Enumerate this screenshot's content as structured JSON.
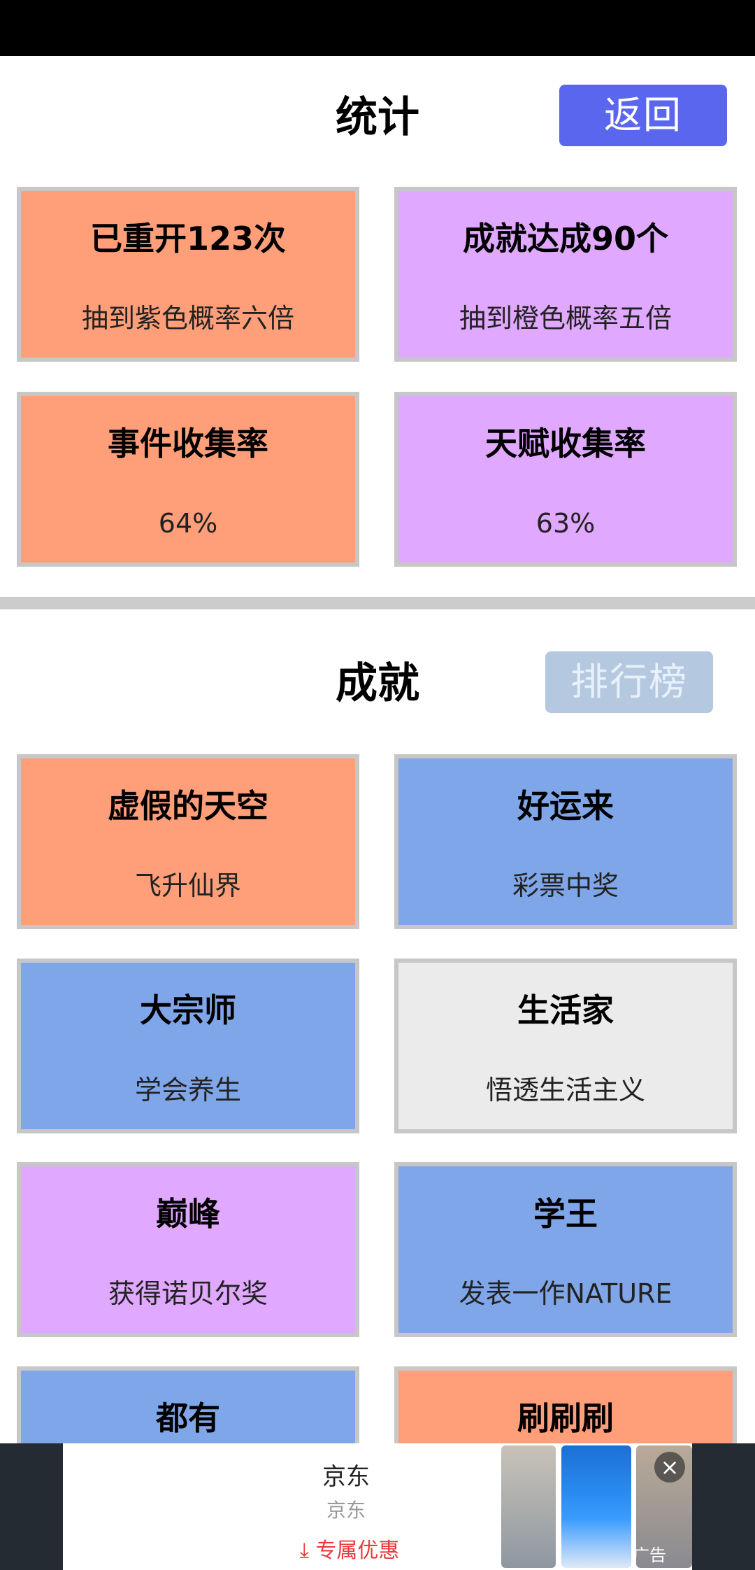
{
  "stats": {
    "title": "统计",
    "back_label": "返回",
    "cards": [
      {
        "title": "已重开123次",
        "sub": "抽到紫色概率六倍",
        "color": "#ff9f7a"
      },
      {
        "title": "成就达成90个",
        "sub": "抽到橙色概率五倍",
        "color": "#e0a8ff"
      },
      {
        "title": "事件收集率",
        "sub": "64%",
        "color": "#ff9f7a"
      },
      {
        "title": "天赋收集率",
        "sub": "63%",
        "color": "#e0a8ff"
      }
    ]
  },
  "achievements": {
    "title": "成就",
    "rank_label": "排行榜",
    "cards": [
      {
        "title": "虚假的天空",
        "sub": "飞升仙界",
        "color": "#ff9f7a"
      },
      {
        "title": "好运来",
        "sub": "彩票中奖",
        "color": "#80a6ea"
      },
      {
        "title": "大宗师",
        "sub": "学会养生",
        "color": "#80a6ea"
      },
      {
        "title": "生活家",
        "sub": "悟透生活主义",
        "color": "#ebebeb"
      },
      {
        "title": "巅峰",
        "sub": "获得诺贝尔奖",
        "color": "#e0a8ff"
      },
      {
        "title": "学王",
        "sub": "发表一作NATURE",
        "color": "#80a6ea"
      },
      {
        "title": "都有",
        "sub": "",
        "color": "#80a6ea"
      },
      {
        "title": "刷刷刷",
        "sub": "",
        "color": "#ff9f7a"
      }
    ]
  },
  "ad": {
    "title": "京东",
    "subtitle": "京东",
    "cta": "专属优惠",
    "cta_icon": "download-arrow-icon",
    "label": "广告",
    "close_icon": "close-icon"
  }
}
